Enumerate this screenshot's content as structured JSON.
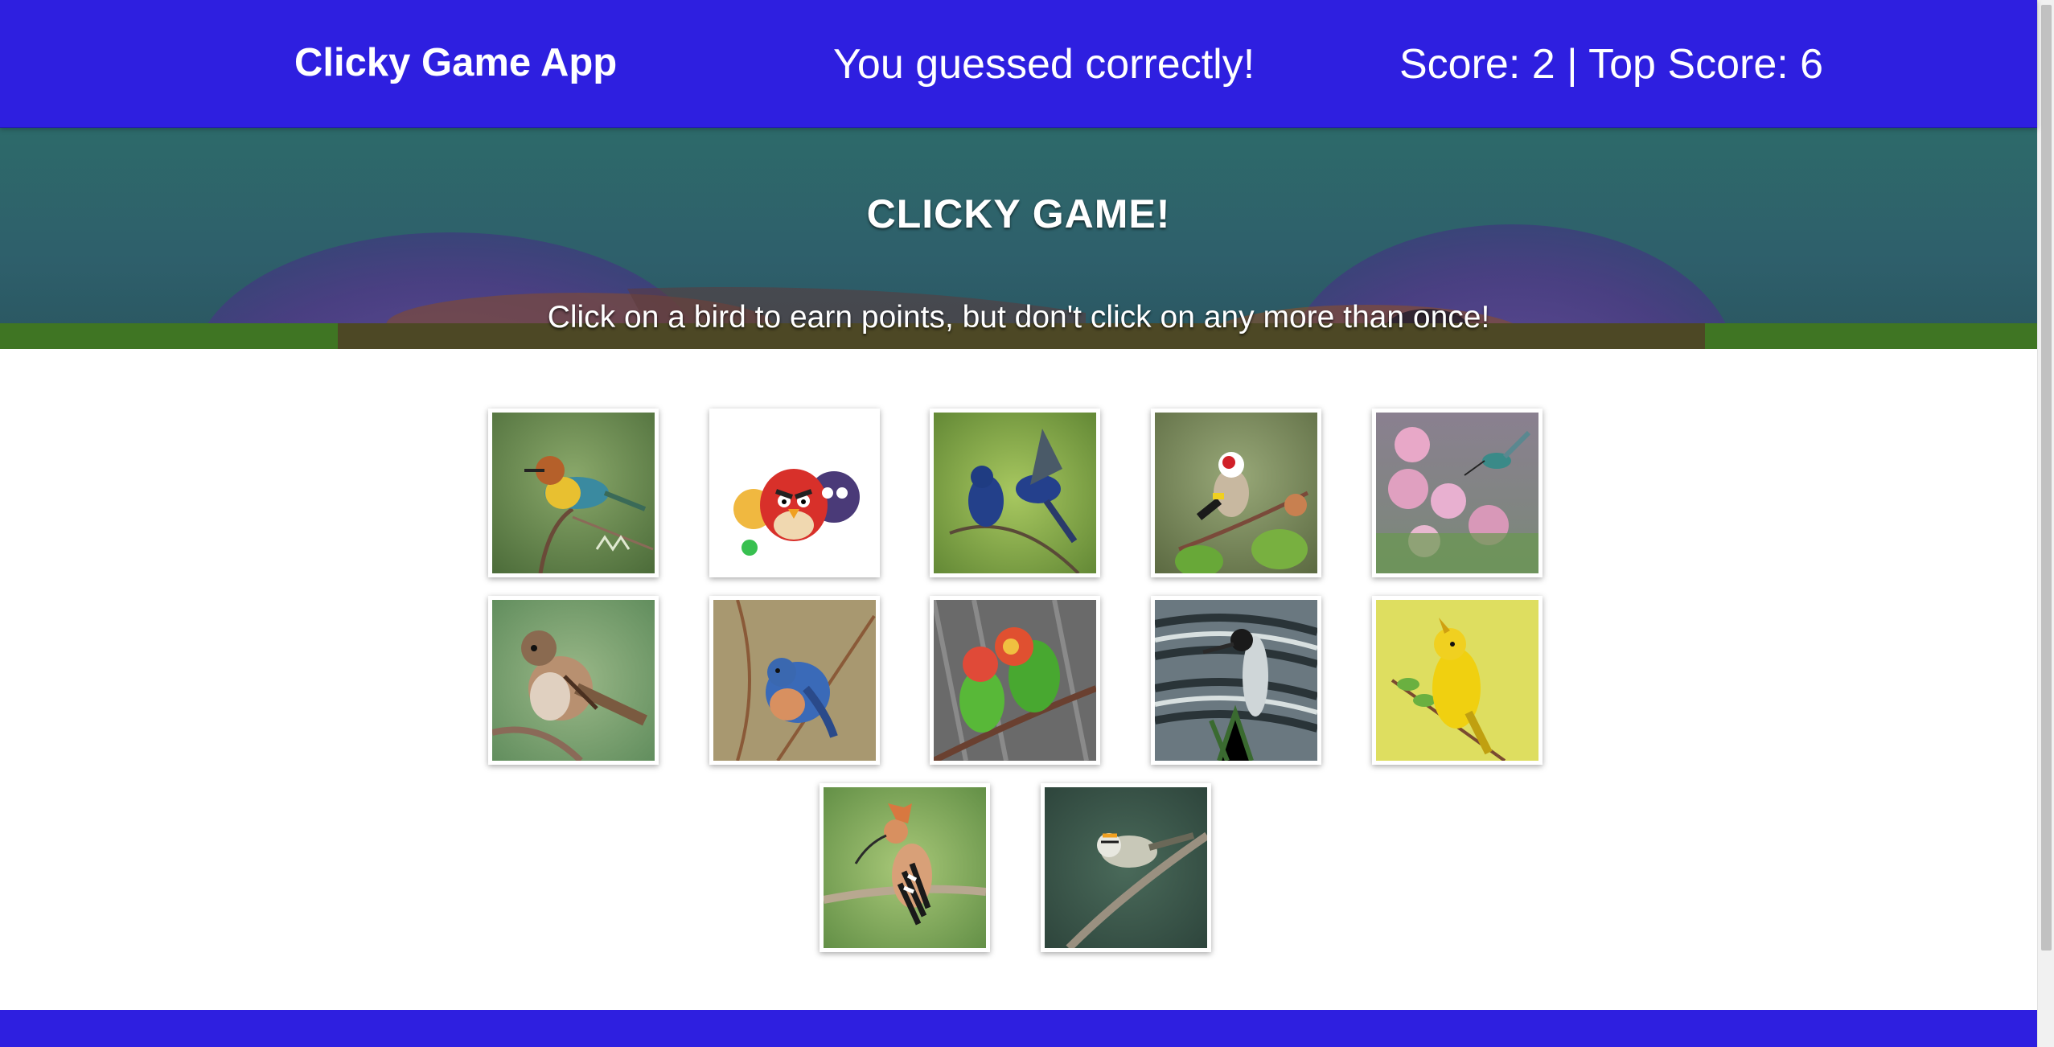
{
  "navbar": {
    "brand": "Clicky Game App",
    "status": "You guessed correctly!",
    "score_text": "Score: 2 | Top Score: 6",
    "color": "#2e1fe0"
  },
  "hero": {
    "title": "CLICKY GAME!",
    "subtitle": "Click on a bird to earn points, but don't click on any more than once!"
  },
  "cards": [
    {
      "subject": "bee-eater-bird"
    },
    {
      "subject": "angry-birds-cartoon"
    },
    {
      "subject": "indigo-buntings"
    },
    {
      "subject": "goldfinch"
    },
    {
      "subject": "hummingbird-flowers"
    },
    {
      "subject": "house-sparrow"
    },
    {
      "subject": "bluebird"
    },
    {
      "subject": "lovebirds"
    },
    {
      "subject": "heron"
    },
    {
      "subject": "yellow-warbler"
    },
    {
      "subject": "hoopoe"
    },
    {
      "subject": "kinglet"
    }
  ],
  "footer": {
    "color": "#2e1fe0"
  }
}
